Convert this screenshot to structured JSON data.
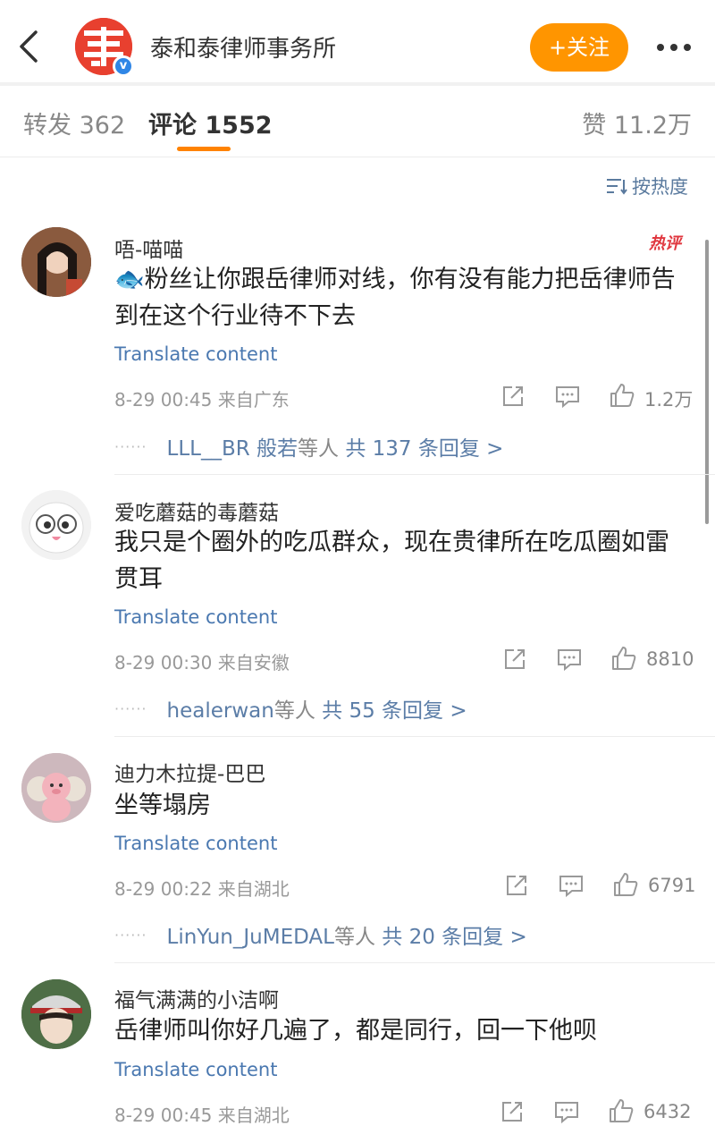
{
  "header": {
    "title": "泰和泰律师事务所",
    "follow_label": "+关注",
    "accent": "#ff9500"
  },
  "tabs": {
    "repost": "转发 362",
    "comments": "评论 1552",
    "likes": "赞 11.2万"
  },
  "sort_label": "按热度",
  "translate_label": "Translate content",
  "hot_badge": "热评",
  "comments": [
    {
      "user": "唔-喵喵",
      "emoji": "🐟",
      "text": "粉丝让你跟岳律师对线，你有没有能力把岳律师告到在这个行业待不下去",
      "time": "8-29 00:45 来自广东",
      "likes": "1.2万",
      "reply_users": "LLL__BR 般若",
      "reply_etc": "等人",
      "reply_total": "共 137 条回复 >"
    },
    {
      "user": "爱吃蘑菇的毒蘑菇",
      "text": "我只是个圈外的吃瓜群众，现在贵律所在吃瓜圈如雷贯耳",
      "time": "8-29 00:30 来自安徽",
      "likes": "8810",
      "reply_users": "healerwan",
      "reply_etc": "等人",
      "reply_total": "共 55 条回复 >"
    },
    {
      "user": "迪力木拉提-巴巴",
      "text": "坐等塌房",
      "time": "8-29 00:22 来自湖北",
      "likes": "6791",
      "reply_users": "LinYun_JuMEDAL",
      "reply_etc": "等人",
      "reply_total": "共 20 条回复 >"
    },
    {
      "user": "福气满满的小洁啊",
      "text": "岳律师叫你好几遍了，都是同行，回一下他呗",
      "time": "8-29 00:45 来自湖北",
      "likes": "6432"
    }
  ]
}
